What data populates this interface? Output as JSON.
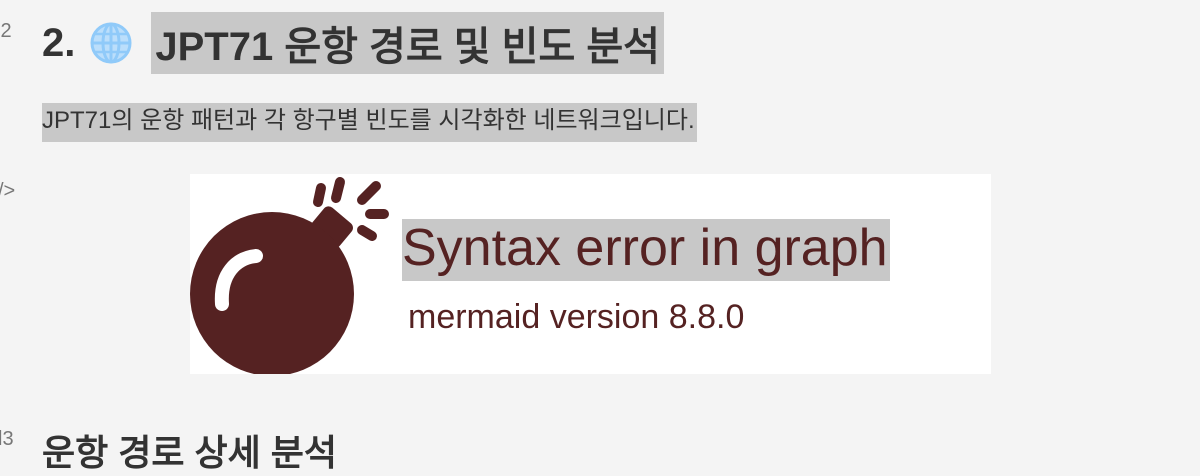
{
  "gutter": {
    "line_a": "l2",
    "line_b": "/>",
    "line_c": "l3"
  },
  "section": {
    "number": "2.",
    "icon": "globe-icon",
    "title": "JPT71 운항 경로 및 빈도 분석",
    "description": "JPT71의 운항 패턴과 각 항구별 빈도를 시각화한 네트워크입니다."
  },
  "diagram_error": {
    "icon": "bomb-icon",
    "title": "Syntax error in graph",
    "version": "mermaid version 8.8.0",
    "color": "#552222"
  },
  "next_heading": {
    "title": "운항 경로 상세 분석"
  },
  "colors": {
    "background": "#f4f4f4",
    "highlight": "#c8c8c8",
    "globe": "#90caf9"
  }
}
